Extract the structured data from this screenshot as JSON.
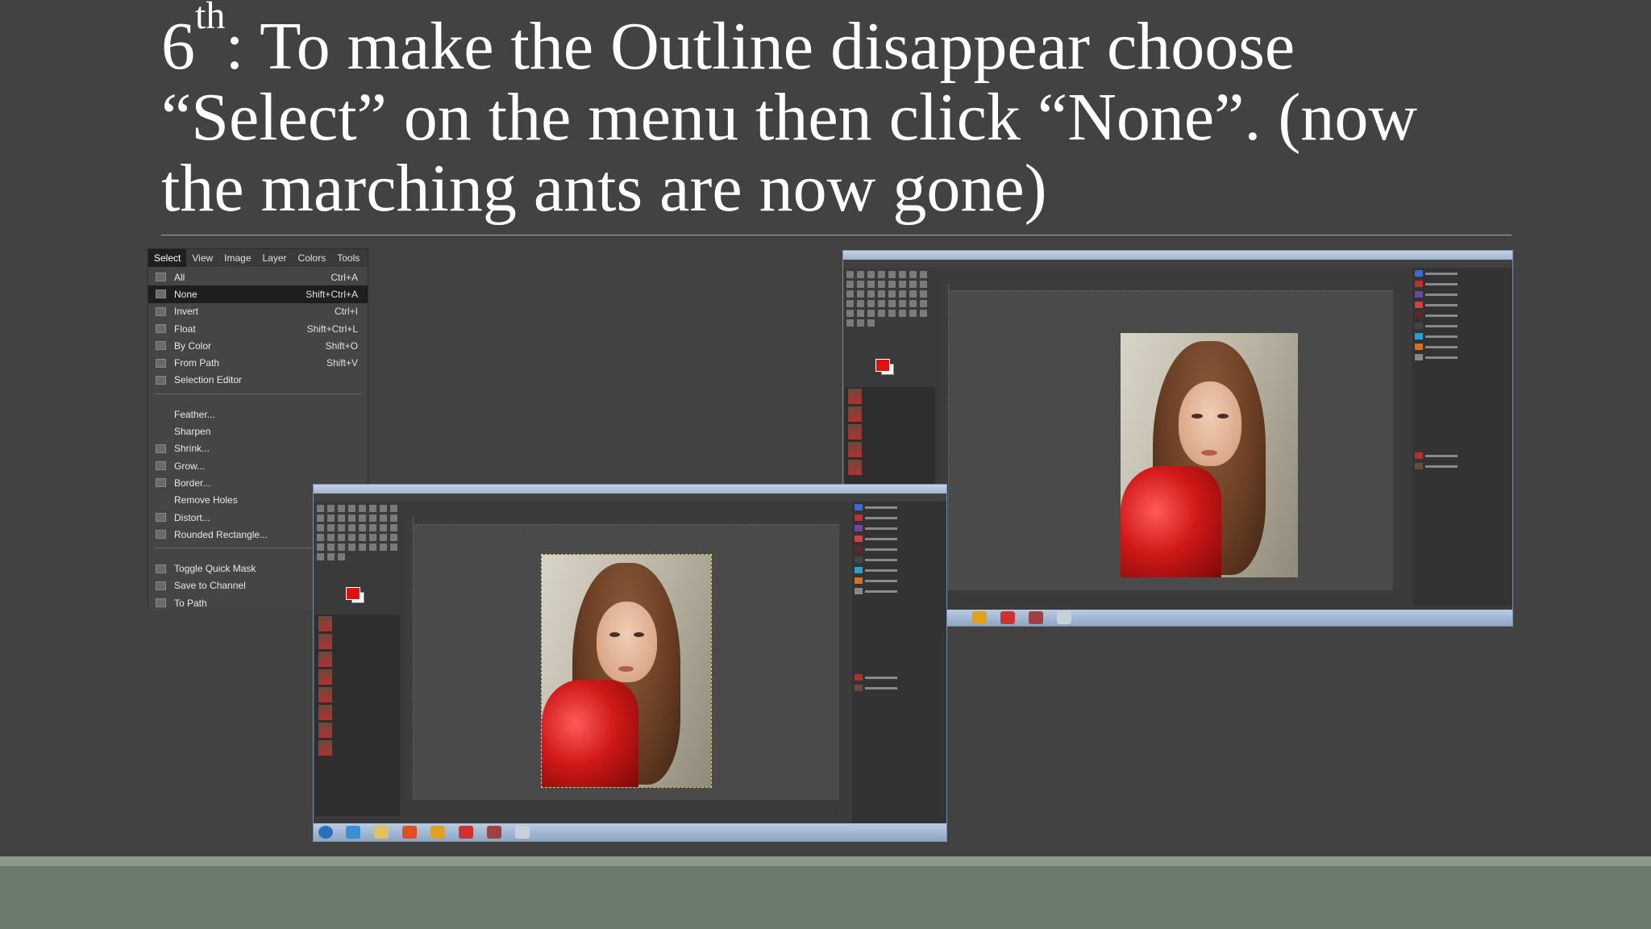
{
  "slide": {
    "title_prefix": "6",
    "title_sup": "th",
    "title_rest": ": To make the Outline disappear choose “Select” on the menu then click “None”. (now the marching ants are now gone)"
  },
  "menu": {
    "bar": [
      "Select",
      "View",
      "Image",
      "Layer",
      "Colors",
      "Tools"
    ],
    "items_group1": [
      {
        "label": "All",
        "shortcut": "Ctrl+A",
        "icon": "select-all-icon"
      },
      {
        "label": "None",
        "shortcut": "Shift+Ctrl+A",
        "icon": "select-none-icon",
        "highlighted": true
      },
      {
        "label": "Invert",
        "shortcut": "Ctrl+I",
        "icon": "invert-icon"
      },
      {
        "label": "Float",
        "shortcut": "Shift+Ctrl+L",
        "icon": "float-icon"
      },
      {
        "label": "By Color",
        "shortcut": "Shift+O",
        "icon": "by-color-icon"
      },
      {
        "label": "From Path",
        "shortcut": "Shift+V",
        "icon": "from-path-icon"
      },
      {
        "label": "Selection Editor",
        "shortcut": "",
        "icon": "selection-editor-icon"
      }
    ],
    "items_group2": [
      {
        "label": "Feather...",
        "icon": ""
      },
      {
        "label": "Sharpen",
        "icon": ""
      },
      {
        "label": "Shrink...",
        "icon": "shrink-icon"
      },
      {
        "label": "Grow...",
        "icon": "grow-icon"
      },
      {
        "label": "Border...",
        "icon": "border-icon"
      },
      {
        "label": "Remove Holes",
        "icon": ""
      },
      {
        "label": "Distort...",
        "icon": "distort-icon"
      },
      {
        "label": "Rounded Rectangle...",
        "icon": "rounded-rect-icon"
      }
    ],
    "items_group3": [
      {
        "label": "Toggle Quick Mask",
        "icon": "quick-mask-icon"
      },
      {
        "label": "Save to Channel",
        "icon": "channel-icon"
      },
      {
        "label": "To Path",
        "icon": "path-icon"
      }
    ]
  },
  "colors": {
    "background": "#424242",
    "footer": "#6b7a6b",
    "foreground_color": "#e01010",
    "menu_highlight": "#1e1e1e"
  }
}
